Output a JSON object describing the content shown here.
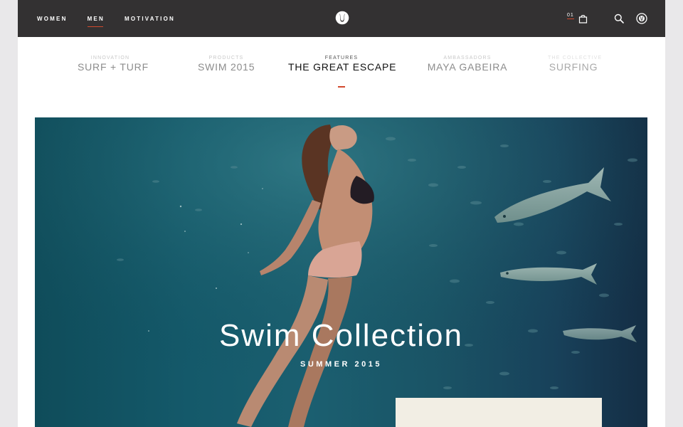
{
  "topbar": {
    "nav": [
      {
        "label": "WOMEN",
        "active": false
      },
      {
        "label": "MEN",
        "active": true
      },
      {
        "label": "MOTIVATION",
        "active": false
      }
    ],
    "logo_icon": "lululemon-logo-icon",
    "cart_count": "01",
    "cart_icon": "shopping-bag-icon",
    "search_icon": "search-icon",
    "account_icon": "account-icon",
    "bg_color": "#333132",
    "accent_color": "#d2492d"
  },
  "subnav": [
    {
      "category": "INNOVATION",
      "title": "SURF + TURF"
    },
    {
      "category": "PRODUCTS",
      "title": "SWIM 2015"
    },
    {
      "category": "FEATURES",
      "title": "THE GREAT ESCAPE"
    },
    {
      "category": "AMBASSADORS",
      "title": "MAYA GABEIRA"
    },
    {
      "category": "THE COLLECTIVE",
      "title": "SURFING"
    }
  ],
  "hero": {
    "title": "Swim Collection",
    "subtitle": "SUMMER 2015",
    "water_color": "#1b5f70"
  }
}
